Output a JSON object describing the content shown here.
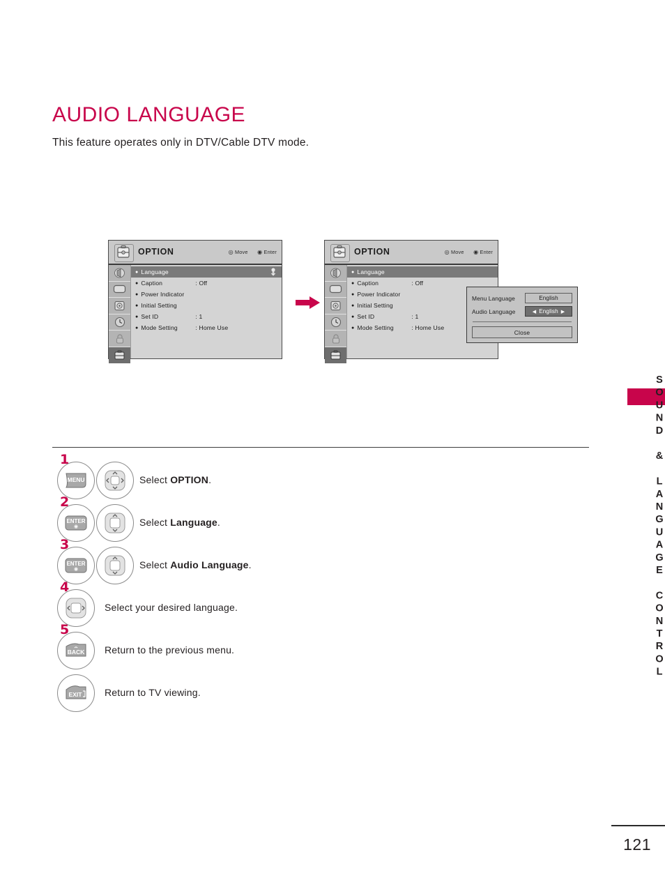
{
  "page": {
    "title": "AUDIO LANGUAGE",
    "subtitle": "This feature operates only in DTV/Cable DTV mode.",
    "side_tab_text": "SOUND & LANGUAGE CONTROL",
    "page_number": "121",
    "accent_color": "#c8054b"
  },
  "osd": {
    "title": "OPTION",
    "hint_move": "Move",
    "hint_enter": "Enter",
    "rail_icons": [
      "picture-icon",
      "screen-icon",
      "audio-icon",
      "time-icon",
      "lock-icon",
      "option-icon"
    ],
    "rows": [
      {
        "label": "Language",
        "value": "",
        "selected": true
      },
      {
        "label": "Caption",
        "value": ": Off",
        "selected": false
      },
      {
        "label": "Power Indicator",
        "value": "",
        "selected": false
      },
      {
        "label": "Initial Setting",
        "value": "",
        "selected": false
      },
      {
        "label": "Set ID",
        "value": ": 1",
        "selected": false
      },
      {
        "label": "Mode Setting",
        "value": ": Home Use",
        "selected": false
      }
    ]
  },
  "popup": {
    "menu_language_label": "Menu Language",
    "menu_language_value": "English",
    "audio_language_label": "Audio Language",
    "audio_language_value": "English",
    "arrow_left": "◀",
    "arrow_right": "▶",
    "close_label": "Close"
  },
  "steps": [
    {
      "num": "1",
      "key": "MENU",
      "pad": "four-way",
      "text_prefix": "Select ",
      "text_bold": "OPTION",
      "text_suffix": "."
    },
    {
      "num": "2",
      "key": "ENTER",
      "pad": "up-down",
      "text_prefix": "Select ",
      "text_bold": "Language",
      "text_suffix": "."
    },
    {
      "num": "3",
      "key": "ENTER",
      "pad": "up-down",
      "text_prefix": "Select ",
      "text_bold": "Audio Language",
      "text_suffix": "."
    },
    {
      "num": "4",
      "key": "",
      "pad": "left-right",
      "text_prefix": "Select your desired language.",
      "text_bold": "",
      "text_suffix": ""
    },
    {
      "num": "5",
      "key": "BACK",
      "pad": "",
      "text_prefix": "Return to the previous menu.",
      "text_bold": "",
      "text_suffix": ""
    },
    {
      "num": "",
      "key": "EXIT",
      "pad": "",
      "text_prefix": "Return to TV viewing.",
      "text_bold": "",
      "text_suffix": ""
    }
  ]
}
